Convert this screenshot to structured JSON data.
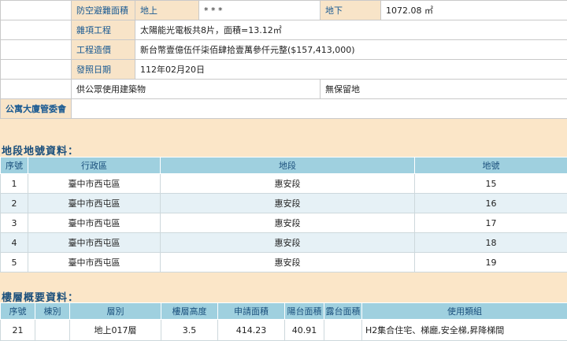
{
  "info": {
    "shelter_label": "防空避難面積",
    "above_label": "地上",
    "above_value": "* * *",
    "below_label": "地下",
    "below_value": "1072.08 ㎡",
    "misc_label": "雜項工程",
    "misc_value": "太陽能光電板共8片，面積=13.12㎡",
    "cost_label": "工程造價",
    "cost_value": "新台幣壹億伍仟柒佰肆拾壹萬參仟元整($157,413,000)",
    "issue_label": "發照日期",
    "issue_value": "112年02月20日",
    "public_use": "供公眾使用建築物",
    "reserve": "無保留地",
    "committee_label": "公寓大廈管委會"
  },
  "land": {
    "title": "地段地號資料：",
    "headers": [
      "序號",
      "行政區",
      "地段",
      "地號"
    ],
    "rows": [
      [
        "1",
        "臺中市西屯區",
        "惠安段",
        "15"
      ],
      [
        "2",
        "臺中市西屯區",
        "惠安段",
        "16"
      ],
      [
        "3",
        "臺中市西屯區",
        "惠安段",
        "17"
      ],
      [
        "4",
        "臺中市西屯區",
        "惠安段",
        "18"
      ],
      [
        "5",
        "臺中市西屯區",
        "惠安段",
        "19"
      ]
    ]
  },
  "floor": {
    "title": "樓層概要資料：",
    "headers": [
      "序號",
      "棟別",
      "層別",
      "樓層高度",
      "申請面積",
      "陽台面積",
      "露台面積",
      "使用類組"
    ],
    "rows": [
      [
        "21",
        "",
        "地上017層",
        "3.5",
        "414.23",
        "40.91",
        "",
        "H2集合住宅、梯廳,安全梯,昇降梯間"
      ]
    ]
  }
}
